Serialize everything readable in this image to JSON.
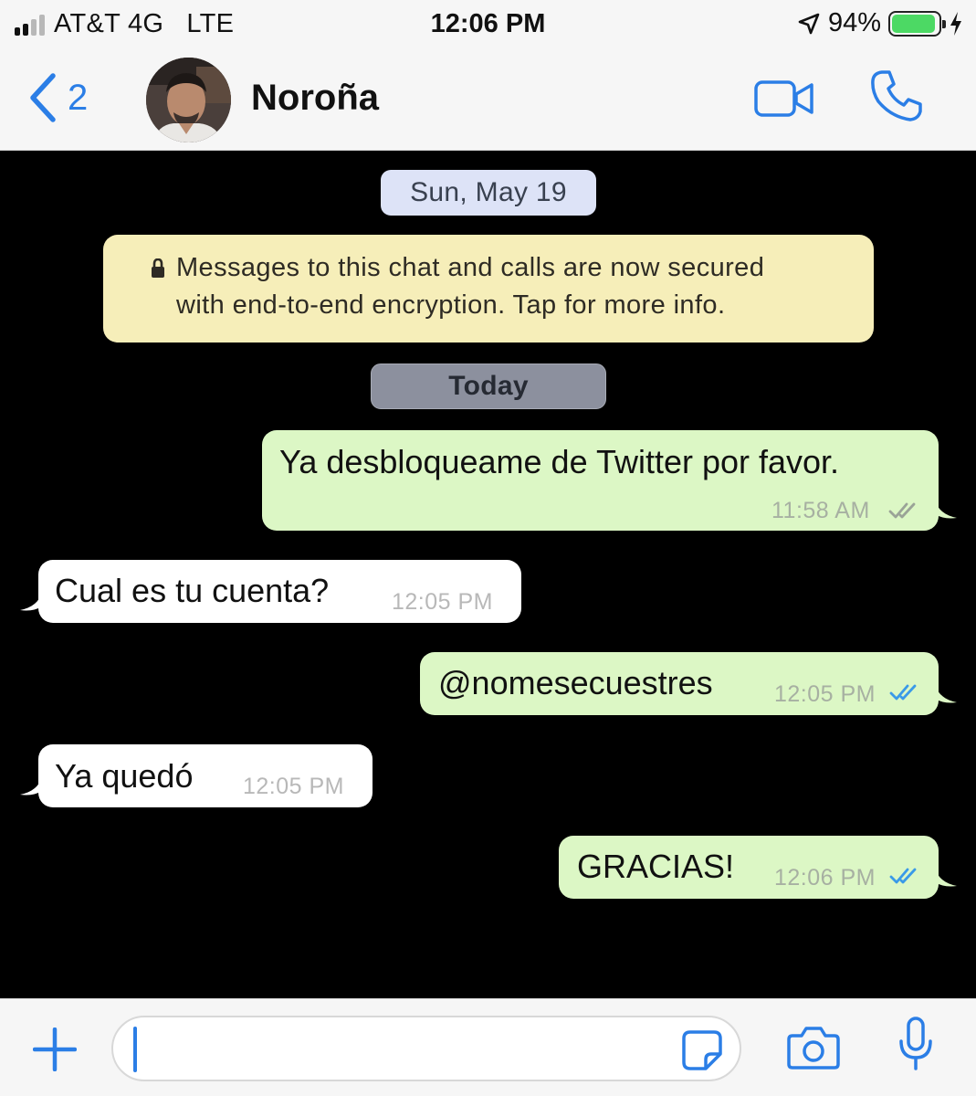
{
  "status_bar": {
    "carrier": "AT&T 4G   LTE",
    "time": "12:06 PM",
    "battery": "94%",
    "battery_level": 0.94,
    "icons": [
      "signal-icon",
      "location-arrow-icon",
      "battery-icon",
      "charging-bolt-icon"
    ]
  },
  "header": {
    "back_count": "2",
    "contact_name": "Noroña",
    "icons": [
      "back-chevron-icon",
      "contact-avatar",
      "video-call-icon",
      "phone-icon"
    ]
  },
  "chat": {
    "date_sunday": "Sun, May 19",
    "encryption_line1": "Messages to this chat and calls are now secured",
    "encryption_line2": "with end-to-end encryption. Tap for more info.",
    "date_today": "Today",
    "messages": [
      {
        "direction": "outgoing",
        "text": "Ya desbloqueame de Twitter por favor.",
        "time": "11:58 AM",
        "status": "delivered"
      },
      {
        "direction": "incoming",
        "text": "Cual es tu cuenta?",
        "time": "12:05 PM"
      },
      {
        "direction": "outgoing",
        "text": "@nomesecuestres",
        "time": "12:05 PM",
        "status": "read"
      },
      {
        "direction": "incoming",
        "text": "Ya quedó",
        "time": "12:05 PM"
      },
      {
        "direction": "outgoing",
        "text": "GRACIAS!",
        "time": "12:06 PM",
        "status": "read"
      }
    ]
  },
  "input_bar": {
    "text_value": "",
    "icons": [
      "plus-icon",
      "sticker-icon",
      "camera-icon",
      "microphone-icon"
    ]
  },
  "colors": {
    "accent": "#2b7ee6",
    "outgoing_bubble": "#dcf7c5",
    "incoming_bubble": "#ffffff",
    "encryption_notice": "#f6eeb9",
    "read_ticks": "#3a9ae8",
    "delivered_ticks": "#9aa397",
    "chat_background": "#000000"
  }
}
